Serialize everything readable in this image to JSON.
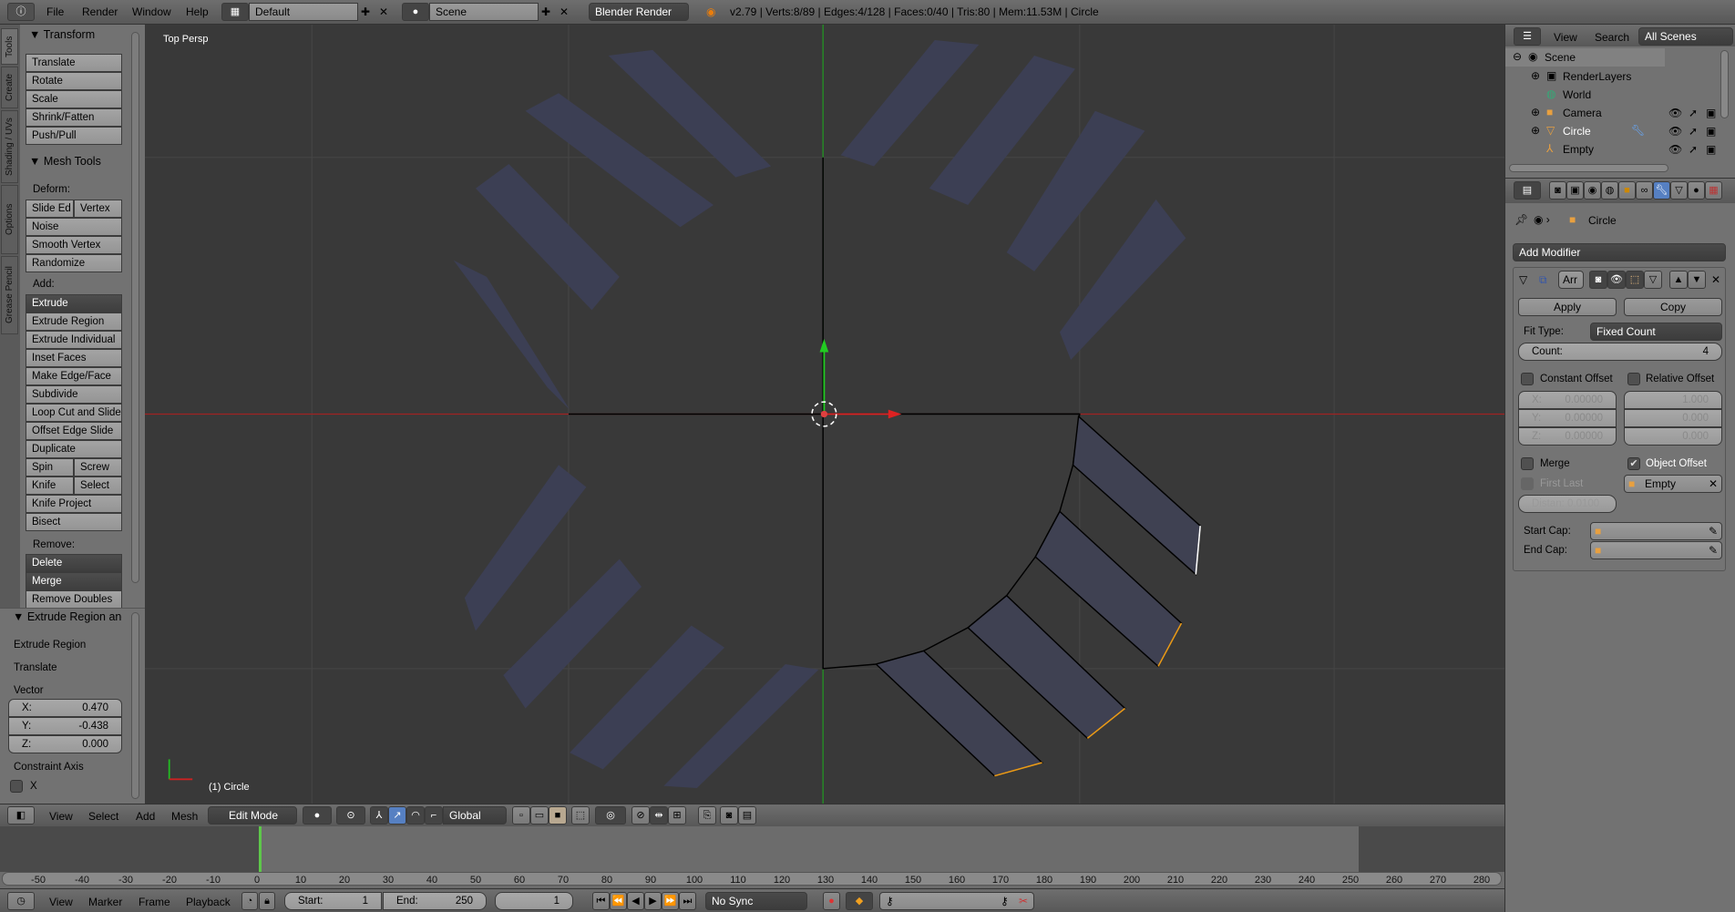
{
  "top_bar": {
    "menus": [
      "File",
      "Render",
      "Window",
      "Help"
    ],
    "layout": "Default",
    "scene": "Scene",
    "engine": "Blender Render",
    "stats": "v2.79 | Verts:8/89 | Edges:4/128 | Faces:0/40 | Tris:80 | Mem:11.53M | Circle"
  },
  "left_tabs": [
    "Tools",
    "Create",
    "Shading / UVs",
    "Options",
    "Grease Pencil"
  ],
  "left_panel": {
    "transform_header": "Transform",
    "transform_buttons": [
      "Translate",
      "Rotate",
      "Scale",
      "Shrink/Fatten",
      "Push/Pull"
    ],
    "mesh_tools_header": "Mesh Tools",
    "deform_label": "Deform:",
    "deform": [
      "Slide Ed",
      "Vertex",
      "Noise",
      "Smooth Vertex",
      "Randomize"
    ],
    "add_label": "Add:",
    "add": [
      "Extrude",
      "Extrude Region",
      "Extrude Individual",
      "Inset Faces",
      "Make Edge/Face",
      "Subdivide",
      "Loop Cut and Slide",
      "Offset Edge Slide",
      "Duplicate",
      "Spin",
      "Screw",
      "Knife",
      "Select",
      "Knife Project",
      "Bisect"
    ],
    "remove_label": "Remove:",
    "remove": [
      "Delete",
      "Merge",
      "Remove Doubles"
    ]
  },
  "operator_panel": {
    "header": "Extrude Region and",
    "items": [
      "Extrude Region",
      "Translate"
    ],
    "vector_label": "Vector",
    "vector": [
      {
        "axis": "X:",
        "value": "0.470"
      },
      {
        "axis": "Y:",
        "value": "-0.438"
      },
      {
        "axis": "Z:",
        "value": "0.000"
      }
    ],
    "constraint_label": "Constraint Axis",
    "constraint_x": "X",
    "constraint_x_checked": false
  },
  "viewport": {
    "view_label": "Top Persp",
    "object_label": "(1) Circle",
    "axis_colors": {
      "x": "#c02020",
      "y": "#20b020"
    }
  },
  "view3d_header": {
    "menus": [
      "View",
      "Select",
      "Add",
      "Mesh"
    ],
    "mode": "Edit Mode",
    "orientation": "Global"
  },
  "timeline": {
    "ticks": [
      -50,
      -40,
      -30,
      -20,
      -10,
      0,
      10,
      20,
      30,
      40,
      50,
      60,
      70,
      80,
      90,
      100,
      110,
      120,
      130,
      140,
      150,
      160,
      170,
      180,
      190,
      200,
      210,
      220,
      230,
      240,
      250,
      260,
      270,
      280
    ],
    "current_frame": 1,
    "start": 1,
    "end": 250,
    "menus": [
      "View",
      "Marker",
      "Frame",
      "Playback"
    ],
    "start_label": "Start:",
    "start_value": "1",
    "end_label": "End:",
    "end_value": "250",
    "frame_value": "1",
    "sync": "No Sync"
  },
  "outliner": {
    "menus": [
      "View",
      "Search"
    ],
    "filter": "All Scenes",
    "rows": [
      {
        "name": "Scene"
      },
      {
        "name": "RenderLayers"
      },
      {
        "name": "World"
      },
      {
        "name": "Camera"
      },
      {
        "name": "Circle"
      },
      {
        "name": "Empty"
      }
    ]
  },
  "properties": {
    "object": "Circle",
    "add_modifier": "Add Modifier",
    "modifier_name": "Arr",
    "apply": "Apply",
    "copy": "Copy",
    "fit_type_label": "Fit Type:",
    "fit_type": "Fixed Count",
    "count_label": "Count:",
    "count": "4",
    "constant_offset": "Constant Offset",
    "constant_offset_checked": false,
    "relative_offset": "Relative Offset",
    "relative_offset_checked": false,
    "const_xyz": [
      {
        "axis": "X:",
        "value": "0.00000"
      },
      {
        "axis": "Y:",
        "value": "0.00000"
      },
      {
        "axis": "Z:",
        "value": "0.00000"
      }
    ],
    "rel_xyz": [
      "1.000",
      "0.000",
      "0.000"
    ],
    "merge": "Merge",
    "merge_checked": false,
    "object_offset": "Object Offset",
    "object_offset_checked": true,
    "object_offset_target": "Empty",
    "first_last": "First Last",
    "distance": "Distan: 0.0100",
    "start_cap": "Start Cap:",
    "end_cap": "End Cap:"
  }
}
